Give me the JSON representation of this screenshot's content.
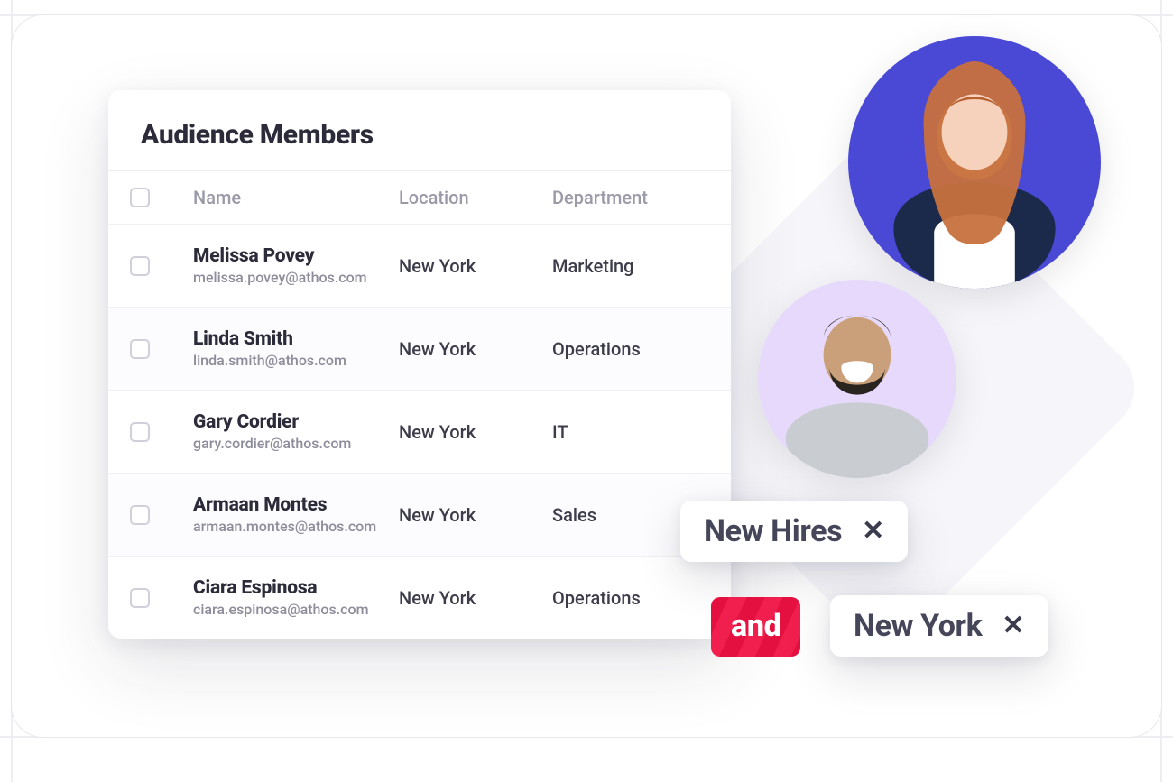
{
  "card": {
    "title": "Audience Members",
    "columns": {
      "name": "Name",
      "location": "Location",
      "department": "Department"
    },
    "rows": [
      {
        "name": "Melissa Povey",
        "email": "melissa.povey@athos.com",
        "location": "New York",
        "department": "Marketing"
      },
      {
        "name": "Linda Smith",
        "email": "linda.smith@athos.com",
        "location": "New York",
        "department": "Operations"
      },
      {
        "name": "Gary Cordier",
        "email": "gary.cordier@athos.com",
        "location": "New York",
        "department": "IT"
      },
      {
        "name": "Armaan Montes",
        "email": "armaan.montes@athos.com",
        "location": "New York",
        "department": "Sales"
      },
      {
        "name": "Ciara Espinosa",
        "email": "ciara.espinosa@athos.com",
        "location": "New York",
        "department": "Operations"
      }
    ]
  },
  "filters": {
    "operator": "and",
    "chips": [
      {
        "label": "New Hires"
      },
      {
        "label": "New York"
      }
    ]
  },
  "colors": {
    "avatar1_bg": "#4a49d6",
    "avatar2_bg": "#e6d9fb",
    "operator_bg": "#e4103f"
  }
}
